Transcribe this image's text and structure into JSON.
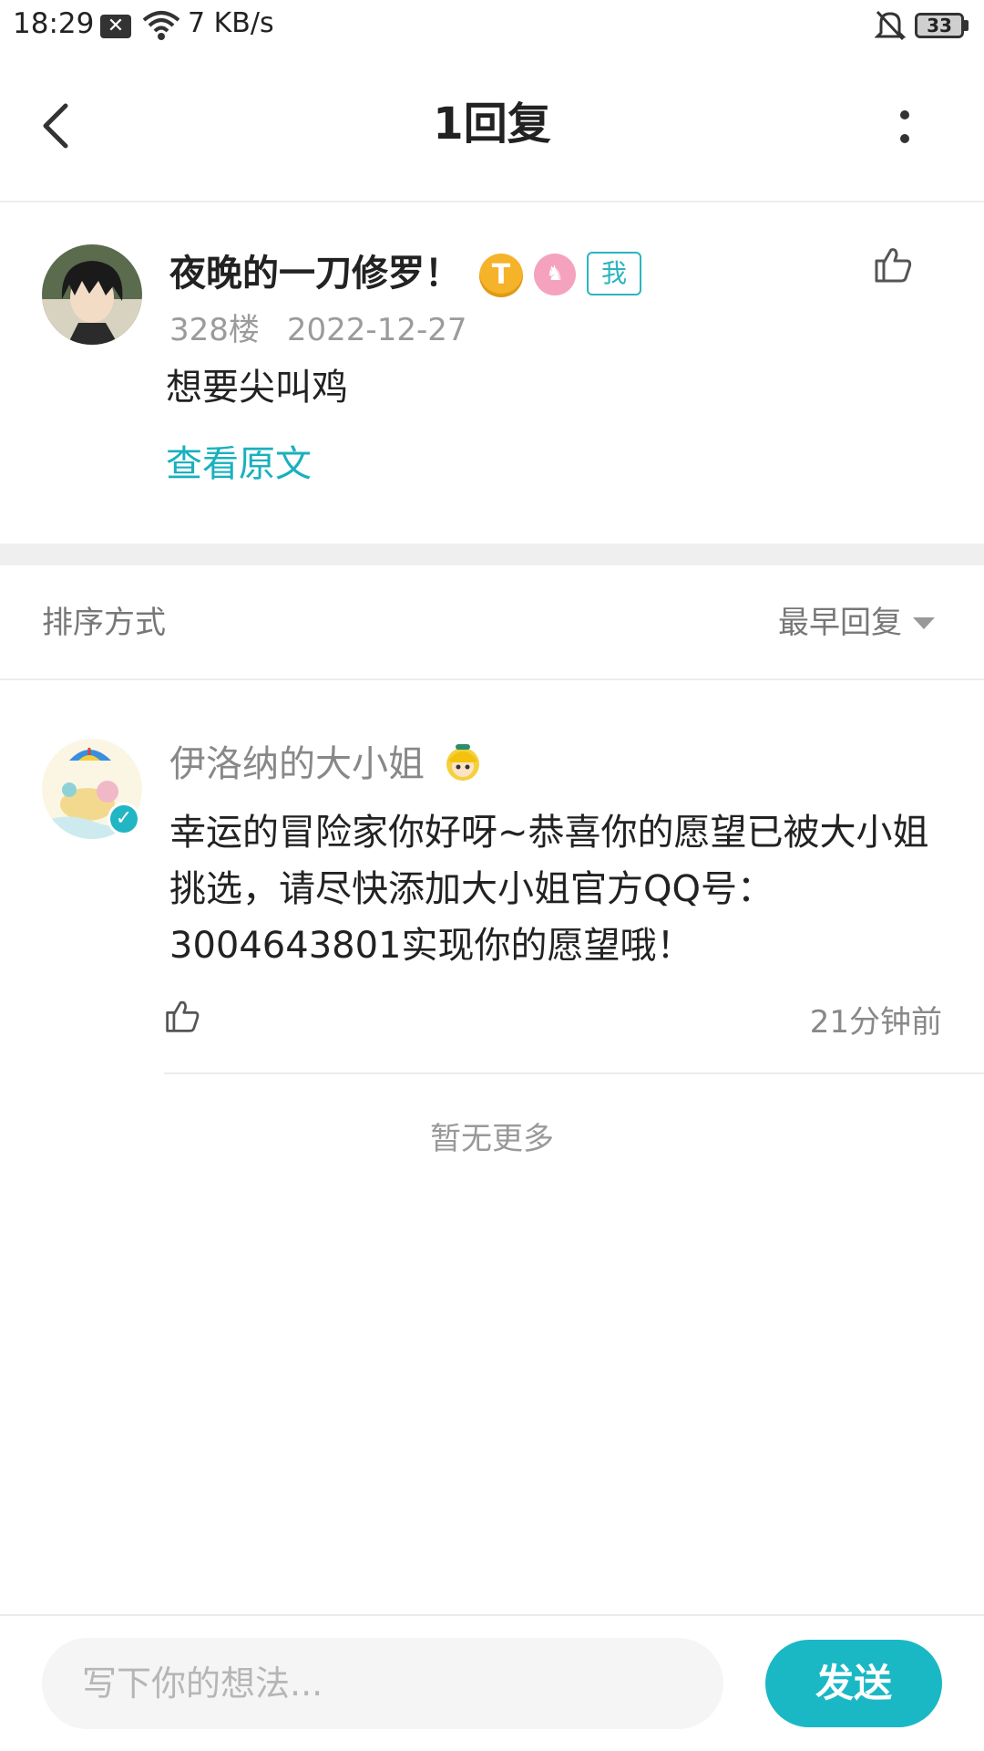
{
  "status_bar": {
    "time": "18:29",
    "network_speed": "7 KB/s",
    "battery": "33"
  },
  "header": {
    "title": "1回复"
  },
  "original_comment": {
    "username": "夜晚的一刀修罗！",
    "badge_t": "T",
    "badge_me": "我",
    "floor": "328楼",
    "date": "2022-12-27",
    "content": "想要尖叫鸡",
    "view_original": "查看原文"
  },
  "sort": {
    "label": "排序方式",
    "value": "最早回复"
  },
  "reply": {
    "username": "伊洛纳的大小姐",
    "content": "幸运的冒险家你好呀~恭喜你的愿望已被大小姐挑选，请尽快添加大小姐官方QQ号：3004643801实现你的愿望哦！",
    "time": "21分钟前"
  },
  "footer_note": "暂无更多",
  "composer": {
    "placeholder": "写下你的想法...",
    "send_label": "发送"
  },
  "colors": {
    "accent": "#1ab8c4",
    "link": "#1ab0bd",
    "muted_text": "#9b9b9b"
  }
}
